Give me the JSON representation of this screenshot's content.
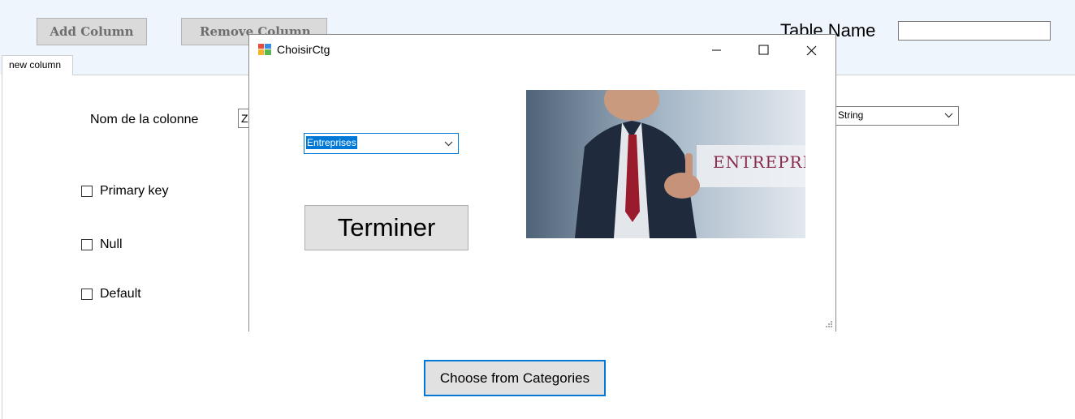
{
  "toolbar": {
    "add_column_label": "Add Column",
    "remove_column_label": "Remove Column",
    "table_name_label": "Table Name",
    "table_name_value": ""
  },
  "tabs": [
    {
      "label": "new column"
    }
  ],
  "form": {
    "column_name_label": "Nom de la colonne",
    "column_name_value": "Z",
    "type_value": "String",
    "primary_key_label": "Primary key",
    "null_label": "Null",
    "default_label": "Default",
    "choose_button_label": "Choose from Categories"
  },
  "dialog": {
    "title": "ChoisirCtg",
    "category_value": "Entreprises",
    "terminer_label": "Terminer",
    "image_caption": "ENTREPRIS"
  },
  "colors": {
    "accent": "#0078d7",
    "toolbar_bg": "#eef5fd",
    "image_text": "#8a2b4c"
  }
}
